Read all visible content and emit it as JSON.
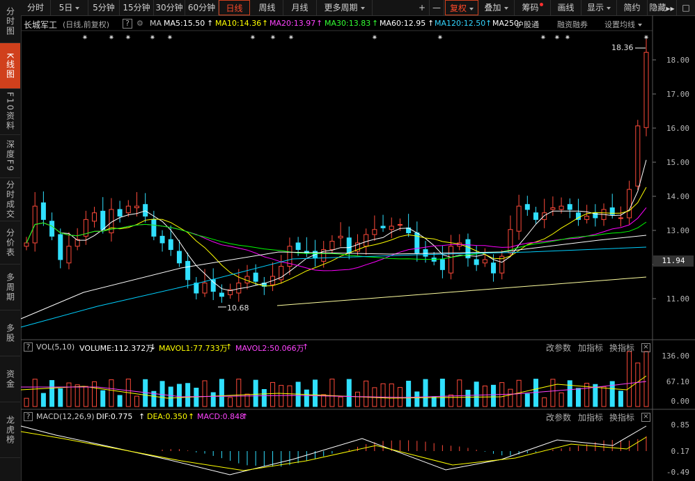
{
  "sidebar": {
    "tabs": [
      {
        "label": "分时图",
        "active": false
      },
      {
        "label": "K线图",
        "active": true
      },
      {
        "label": "F10资料",
        "active": false
      },
      {
        "label": "深度F9",
        "active": false
      },
      {
        "label": "分时成交",
        "active": false
      },
      {
        "label": "分价表",
        "active": false
      },
      {
        "label": "多周期",
        "active": false
      },
      {
        "label": "多股",
        "active": false
      },
      {
        "label": "资金",
        "active": false
      },
      {
        "label": "龙虎榜",
        "active": false
      }
    ]
  },
  "toolbar": {
    "periods": [
      "分时",
      "5日",
      "5分钟",
      "15分钟",
      "30分钟",
      "60分钟",
      "日线",
      "周线",
      "月线",
      "更多周期"
    ],
    "active_period": "日线",
    "plus": "+",
    "minus": "—",
    "fuquan": "复权",
    "overlay": "叠加",
    "chouma": "筹码",
    "draw": "画线",
    "display": "显示",
    "simple": "简约",
    "hide": "隐藏",
    "hide_arrows": "▶▶",
    "restore": "□"
  },
  "main_legend": {
    "stock_name": "长城军工",
    "period_info": "(日线,前复权)",
    "help": "?",
    "ma": "MA",
    "ma5": "MA5:15.50",
    "ma10": "MA10:14.36",
    "ma20": "MA20:13.97",
    "ma30": "MA30:13.83",
    "ma60": "MA60:12.95",
    "ma120": "MA120:12.50",
    "ma250": "MA250:",
    "hugutong": "沪股通",
    "rongzi": "融资融券",
    "set_ma": "设置均线",
    "colors": {
      "ma5": "#ffffff",
      "ma10": "#ffff00",
      "ma20": "#ff00ff",
      "ma30": "#00ff00",
      "ma60": "#ffffff",
      "ma120": "#00d0ff",
      "ma250": "#ffffff"
    }
  },
  "price_axis": {
    "ticks": [
      "18.00",
      "17.00",
      "16.00",
      "15.00",
      "14.00",
      "13.00",
      "12.00",
      "11.00"
    ],
    "current": "11.94",
    "high_label": "18.36",
    "low_label": "10.68"
  },
  "volume_panel": {
    "title": "VOL(5,10)",
    "volume": "VOLUME:112.372万",
    "mavol1": "MAVOL1:77.733万",
    "mavol2": "MAVOL2:50.066万",
    "ticks": [
      "136.00",
      "67.10",
      "0.00"
    ],
    "tools": [
      "改参数",
      "加指标",
      "换指标"
    ]
  },
  "macd_panel": {
    "title": "MACD(12,26,9)",
    "dif": "DIF:0.775",
    "dea": "DEA:0.350",
    "macd": "MACD:0.848",
    "ticks": [
      "0.85",
      "0.17",
      "-0.49"
    ],
    "tools": [
      "改参数",
      "加指标",
      "换指标"
    ]
  },
  "chart_data": {
    "type": "candlestick",
    "series_closes": [
      12.5,
      13.6,
      13.2,
      12.7,
      12.0,
      12.4,
      12.6,
      13.2,
      13.4,
      12.9,
      13.5,
      13.3,
      13.6,
      13.6,
      13.3,
      12.7,
      12.5,
      12.3,
      11.9,
      11.4,
      11.0,
      11.3,
      11.05,
      10.9,
      11.1,
      11.3,
      11.5,
      11.35,
      11.2,
      11.5,
      11.8,
      12.4,
      12.3,
      12.2,
      12.05,
      12.3,
      12.55,
      12.7,
      12.2,
      12.5,
      12.75,
      12.9,
      12.95,
      13.0,
      13.05,
      12.8,
      12.2,
      12.1,
      11.95,
      11.7,
      12.4,
      12.5,
      12.05,
      11.85,
      12.0,
      11.6,
      12.1,
      12.9,
      13.6,
      13.5,
      13.2,
      13.4,
      13.55,
      13.6,
      13.5,
      13.2,
      13.3,
      13.25,
      13.5,
      13.35,
      13.25,
      14.1,
      16.0,
      18.2
    ],
    "ylim": [
      10.5,
      18.6
    ]
  },
  "star_markers": "✷"
}
